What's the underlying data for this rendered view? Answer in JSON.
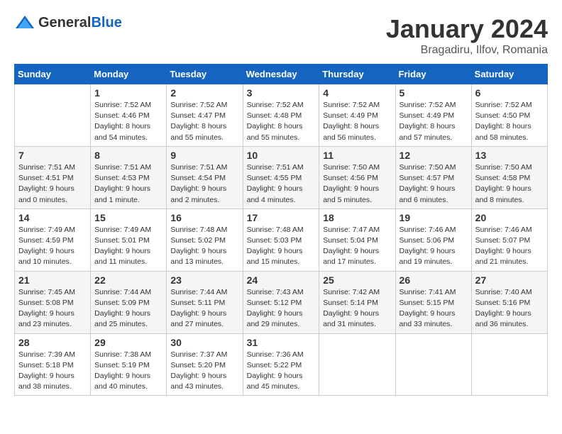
{
  "header": {
    "logo_general": "General",
    "logo_blue": "Blue",
    "month": "January 2024",
    "location": "Bragadiru, Ilfov, Romania"
  },
  "weekdays": [
    "Sunday",
    "Monday",
    "Tuesday",
    "Wednesday",
    "Thursday",
    "Friday",
    "Saturday"
  ],
  "weeks": [
    [
      {
        "day": "",
        "sunrise": "",
        "sunset": "",
        "daylight": ""
      },
      {
        "day": "1",
        "sunrise": "Sunrise: 7:52 AM",
        "sunset": "Sunset: 4:46 PM",
        "daylight": "Daylight: 8 hours and 54 minutes."
      },
      {
        "day": "2",
        "sunrise": "Sunrise: 7:52 AM",
        "sunset": "Sunset: 4:47 PM",
        "daylight": "Daylight: 8 hours and 55 minutes."
      },
      {
        "day": "3",
        "sunrise": "Sunrise: 7:52 AM",
        "sunset": "Sunset: 4:48 PM",
        "daylight": "Daylight: 8 hours and 55 minutes."
      },
      {
        "day": "4",
        "sunrise": "Sunrise: 7:52 AM",
        "sunset": "Sunset: 4:49 PM",
        "daylight": "Daylight: 8 hours and 56 minutes."
      },
      {
        "day": "5",
        "sunrise": "Sunrise: 7:52 AM",
        "sunset": "Sunset: 4:49 PM",
        "daylight": "Daylight: 8 hours and 57 minutes."
      },
      {
        "day": "6",
        "sunrise": "Sunrise: 7:52 AM",
        "sunset": "Sunset: 4:50 PM",
        "daylight": "Daylight: 8 hours and 58 minutes."
      }
    ],
    [
      {
        "day": "7",
        "sunrise": "Sunrise: 7:51 AM",
        "sunset": "Sunset: 4:51 PM",
        "daylight": "Daylight: 9 hours and 0 minutes."
      },
      {
        "day": "8",
        "sunrise": "Sunrise: 7:51 AM",
        "sunset": "Sunset: 4:53 PM",
        "daylight": "Daylight: 9 hours and 1 minute."
      },
      {
        "day": "9",
        "sunrise": "Sunrise: 7:51 AM",
        "sunset": "Sunset: 4:54 PM",
        "daylight": "Daylight: 9 hours and 2 minutes."
      },
      {
        "day": "10",
        "sunrise": "Sunrise: 7:51 AM",
        "sunset": "Sunset: 4:55 PM",
        "daylight": "Daylight: 9 hours and 4 minutes."
      },
      {
        "day": "11",
        "sunrise": "Sunrise: 7:50 AM",
        "sunset": "Sunset: 4:56 PM",
        "daylight": "Daylight: 9 hours and 5 minutes."
      },
      {
        "day": "12",
        "sunrise": "Sunrise: 7:50 AM",
        "sunset": "Sunset: 4:57 PM",
        "daylight": "Daylight: 9 hours and 6 minutes."
      },
      {
        "day": "13",
        "sunrise": "Sunrise: 7:50 AM",
        "sunset": "Sunset: 4:58 PM",
        "daylight": "Daylight: 9 hours and 8 minutes."
      }
    ],
    [
      {
        "day": "14",
        "sunrise": "Sunrise: 7:49 AM",
        "sunset": "Sunset: 4:59 PM",
        "daylight": "Daylight: 9 hours and 10 minutes."
      },
      {
        "day": "15",
        "sunrise": "Sunrise: 7:49 AM",
        "sunset": "Sunset: 5:01 PM",
        "daylight": "Daylight: 9 hours and 11 minutes."
      },
      {
        "day": "16",
        "sunrise": "Sunrise: 7:48 AM",
        "sunset": "Sunset: 5:02 PM",
        "daylight": "Daylight: 9 hours and 13 minutes."
      },
      {
        "day": "17",
        "sunrise": "Sunrise: 7:48 AM",
        "sunset": "Sunset: 5:03 PM",
        "daylight": "Daylight: 9 hours and 15 minutes."
      },
      {
        "day": "18",
        "sunrise": "Sunrise: 7:47 AM",
        "sunset": "Sunset: 5:04 PM",
        "daylight": "Daylight: 9 hours and 17 minutes."
      },
      {
        "day": "19",
        "sunrise": "Sunrise: 7:46 AM",
        "sunset": "Sunset: 5:06 PM",
        "daylight": "Daylight: 9 hours and 19 minutes."
      },
      {
        "day": "20",
        "sunrise": "Sunrise: 7:46 AM",
        "sunset": "Sunset: 5:07 PM",
        "daylight": "Daylight: 9 hours and 21 minutes."
      }
    ],
    [
      {
        "day": "21",
        "sunrise": "Sunrise: 7:45 AM",
        "sunset": "Sunset: 5:08 PM",
        "daylight": "Daylight: 9 hours and 23 minutes."
      },
      {
        "day": "22",
        "sunrise": "Sunrise: 7:44 AM",
        "sunset": "Sunset: 5:09 PM",
        "daylight": "Daylight: 9 hours and 25 minutes."
      },
      {
        "day": "23",
        "sunrise": "Sunrise: 7:44 AM",
        "sunset": "Sunset: 5:11 PM",
        "daylight": "Daylight: 9 hours and 27 minutes."
      },
      {
        "day": "24",
        "sunrise": "Sunrise: 7:43 AM",
        "sunset": "Sunset: 5:12 PM",
        "daylight": "Daylight: 9 hours and 29 minutes."
      },
      {
        "day": "25",
        "sunrise": "Sunrise: 7:42 AM",
        "sunset": "Sunset: 5:14 PM",
        "daylight": "Daylight: 9 hours and 31 minutes."
      },
      {
        "day": "26",
        "sunrise": "Sunrise: 7:41 AM",
        "sunset": "Sunset: 5:15 PM",
        "daylight": "Daylight: 9 hours and 33 minutes."
      },
      {
        "day": "27",
        "sunrise": "Sunrise: 7:40 AM",
        "sunset": "Sunset: 5:16 PM",
        "daylight": "Daylight: 9 hours and 36 minutes."
      }
    ],
    [
      {
        "day": "28",
        "sunrise": "Sunrise: 7:39 AM",
        "sunset": "Sunset: 5:18 PM",
        "daylight": "Daylight: 9 hours and 38 minutes."
      },
      {
        "day": "29",
        "sunrise": "Sunrise: 7:38 AM",
        "sunset": "Sunset: 5:19 PM",
        "daylight": "Daylight: 9 hours and 40 minutes."
      },
      {
        "day": "30",
        "sunrise": "Sunrise: 7:37 AM",
        "sunset": "Sunset: 5:20 PM",
        "daylight": "Daylight: 9 hours and 43 minutes."
      },
      {
        "day": "31",
        "sunrise": "Sunrise: 7:36 AM",
        "sunset": "Sunset: 5:22 PM",
        "daylight": "Daylight: 9 hours and 45 minutes."
      },
      {
        "day": "",
        "sunrise": "",
        "sunset": "",
        "daylight": ""
      },
      {
        "day": "",
        "sunrise": "",
        "sunset": "",
        "daylight": ""
      },
      {
        "day": "",
        "sunrise": "",
        "sunset": "",
        "daylight": ""
      }
    ]
  ]
}
